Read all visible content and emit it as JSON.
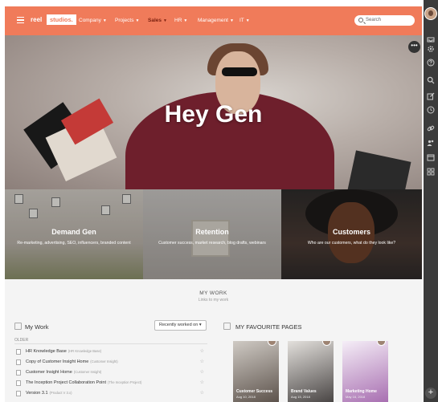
{
  "colors": {
    "brand": "#f07b5a",
    "active_nav": "#7a1f0e",
    "sidebar": "#3b3b3b"
  },
  "nav": {
    "logo_prefix": "reel",
    "logo_name": "studios.",
    "items": [
      {
        "label": "Company",
        "active": false
      },
      {
        "label": "Projects",
        "active": false
      },
      {
        "label": "Sales",
        "active": true
      },
      {
        "label": "HR",
        "active": false
      },
      {
        "label": "Management",
        "active": false
      },
      {
        "label": "IT",
        "active": false
      }
    ],
    "search_placeholder": "Search"
  },
  "hero": {
    "title": "Hey Gen",
    "more_glyph": "•••"
  },
  "tiles": [
    {
      "title": "Demand Gen",
      "description": "Re-marketing, advertising, SEO, influencers, branded content"
    },
    {
      "title": "Retention",
      "description": "Customer success, market research, blog drafts, webinars"
    },
    {
      "title": "Customers",
      "description": "Who are our customers, what do they look like?"
    }
  ],
  "my_work": {
    "heading": "MY WORK",
    "subheading": "Links to my work",
    "panel_title": "My Work",
    "dropdown_value": "Recently worked on",
    "section_label": "OLDER",
    "items": [
      {
        "name": "HR Knowledge Base",
        "space": "(HR Knowledge Base)"
      },
      {
        "name": "Copy of Customer Insight Home",
        "space": "(Customer Insight)"
      },
      {
        "name": "Customer Insight Home",
        "space": "(Customer Insight)"
      },
      {
        "name": "The Inception Project Collaboration Point",
        "space": "(The Inception Project)"
      },
      {
        "name": "Version 3.1",
        "space": "(Product V 3.x)"
      }
    ]
  },
  "favourites": {
    "title": "MY FAVOURITE PAGES",
    "cards": [
      {
        "label": "Customer Success",
        "date": "Aug 10, 2018"
      },
      {
        "label": "Brand Values",
        "date": "Aug 15, 2018"
      },
      {
        "label": "Marketing Home",
        "date": "May 16, 2018"
      }
    ]
  },
  "sidebar_icons": [
    "avatar",
    "inbox-icon",
    "gear-icon",
    "help-icon",
    "search-icon",
    "edit-icon",
    "clock-icon",
    "link-icon",
    "people-icon",
    "calendar-icon",
    "apps-icon",
    "plus-icon"
  ]
}
